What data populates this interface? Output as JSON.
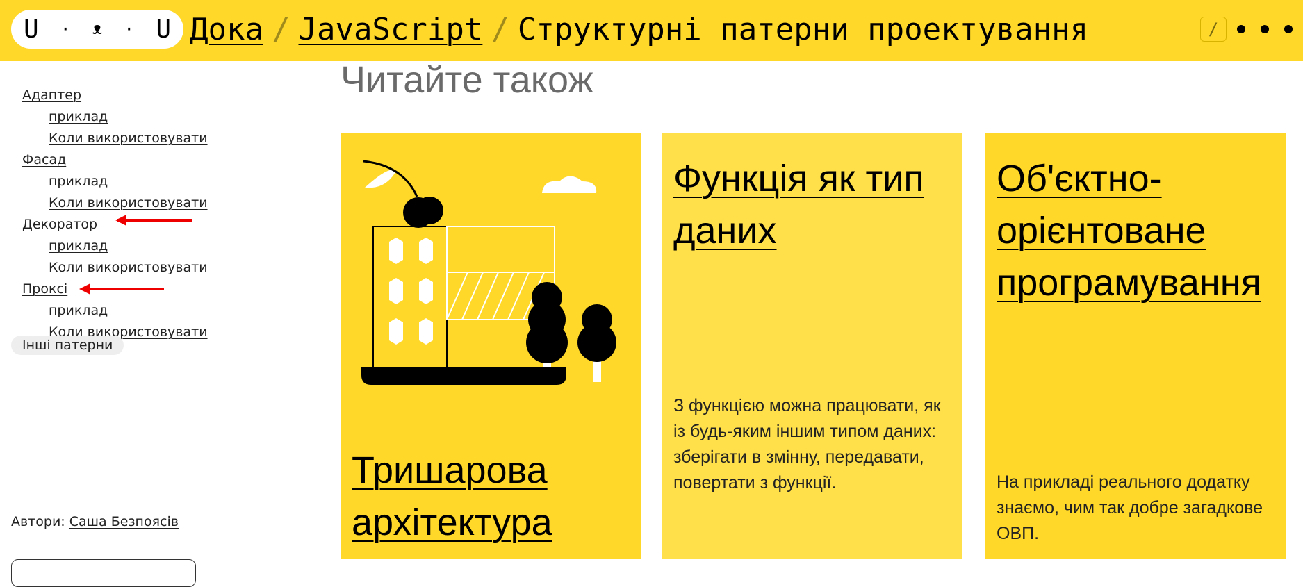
{
  "header": {
    "logo_letters": [
      "U",
      "·",
      "ᴥ",
      "·",
      "U"
    ],
    "breadcrumbs": [
      {
        "label": "Дока"
      },
      {
        "label": "JavaScript"
      }
    ],
    "current_page": "Структурні патерни проектування",
    "slash_key": "/",
    "accent_color": "#ffd829"
  },
  "sidebar": {
    "toc": [
      {
        "label": "Адаптер",
        "children": [
          "приклад",
          "Коли використовувати"
        ]
      },
      {
        "label": "Фасад",
        "children": [
          "приклад",
          "Коли використовувати"
        ]
      },
      {
        "label": "Декоратор",
        "children": [
          "приклад",
          "Коли використовувати"
        ]
      },
      {
        "label": "Проксі",
        "children": [
          "приклад",
          "Коли використовувати"
        ]
      }
    ],
    "other_patterns": "Інші патерни",
    "authors_label": "Автори:",
    "author_name": "Саша Безпоясів"
  },
  "main": {
    "read_also": "Читайте також",
    "cards": [
      {
        "title": "Тришарова архітектура",
        "description": ""
      },
      {
        "title": "Функція як тип даних",
        "description": "З функцією можна працювати, як із будь-яким іншим типом даних: зберігати в змінну, передавати, повертати з функції."
      },
      {
        "title": "Об'єктно-орієнтоване програмування",
        "description": "На прикладі реального додатку знаємо, чим так добре загадкове ОВП."
      }
    ]
  }
}
